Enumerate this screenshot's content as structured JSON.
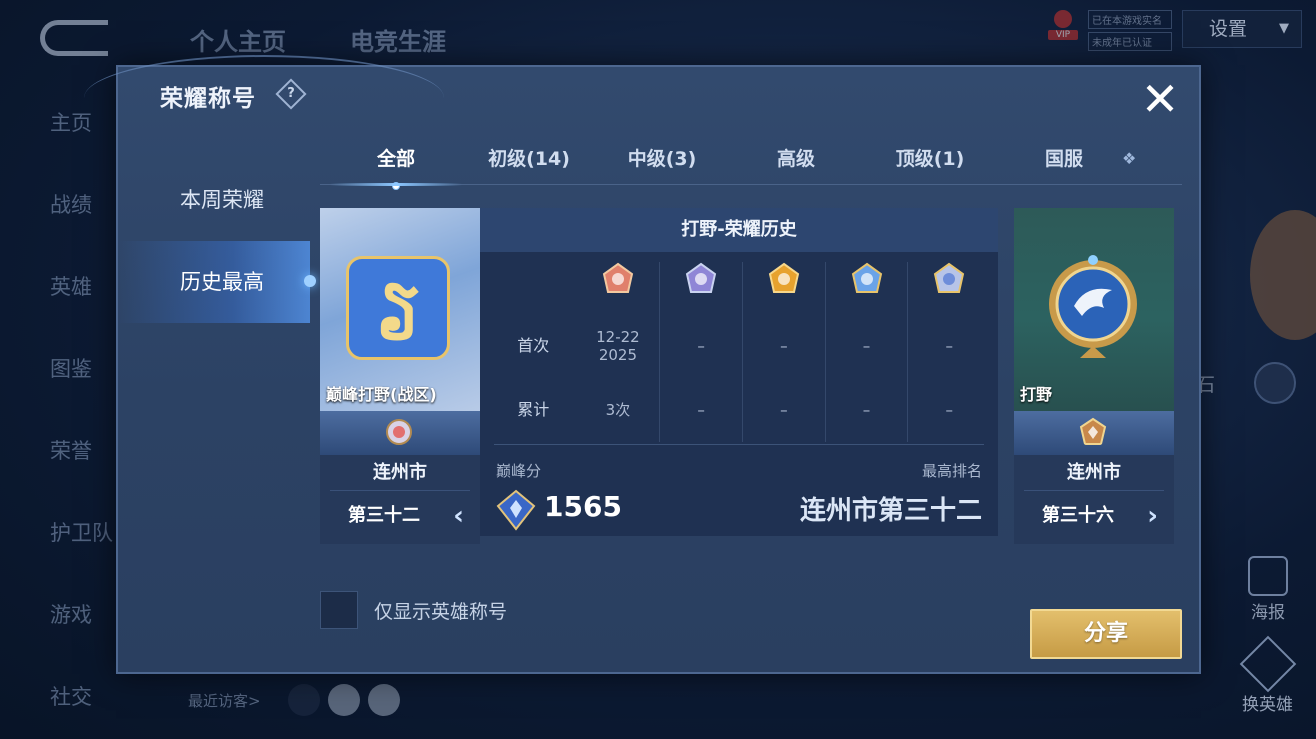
{
  "background": {
    "top_tabs": [
      "个人主页",
      "电竞生涯"
    ],
    "nav_items": [
      "主页",
      "战绩",
      "英雄",
      "图鉴",
      "荣誉",
      "护卫队",
      "游戏",
      "社交"
    ],
    "vip_tag": "VIP",
    "auth_lines": [
      "已在本游戏实名",
      "未成年已认证"
    ],
    "settings_label": "设置",
    "visitors_label": "最近访客>",
    "poster_label": "海报",
    "swap_hero_label": "换英雄",
    "stone_text": "石"
  },
  "modal": {
    "title": "荣耀称号",
    "help_glyph": "?",
    "close_glyph": "✕",
    "side_nav": [
      {
        "label": "本周荣耀",
        "active": false
      },
      {
        "label": "历史最高",
        "active": true
      }
    ],
    "tabs": [
      {
        "label": "全部",
        "active": true
      },
      {
        "label": "初级(14)",
        "active": false
      },
      {
        "label": "中级(3)",
        "active": false
      },
      {
        "label": "高级",
        "active": false
      },
      {
        "label": "顶级(1)",
        "active": false
      },
      {
        "label": "国服",
        "active": false
      }
    ],
    "tab_more_glyph": "❖",
    "left_card": {
      "caption": "巅峰打野(战区)",
      "emblem_glyph": "ຽ",
      "city": "连州市",
      "rank": "第三十二",
      "arrow": "‹"
    },
    "right_card": {
      "caption": "打野",
      "city": "连州市",
      "rank": "第三十六",
      "arrow": "›"
    },
    "history": {
      "header": "打野-荣耀历史",
      "medal_colors": [
        "#e0806c",
        "#8f86d6",
        "#e7a22e",
        "#6aa3e8",
        "#b7c4e8"
      ],
      "rows": [
        {
          "label": "首次",
          "values": [
            "12-22\n2025",
            "–",
            "–",
            "–",
            "–"
          ]
        },
        {
          "label": "累计",
          "values": [
            "3次",
            "–",
            "–",
            "–",
            "–"
          ]
        }
      ],
      "peak_label": "巅峰分",
      "peak_score": "1565",
      "best_label": "最高排名",
      "best_rank": "连州市第三十二"
    },
    "checkbox_label": "仅显示英雄称号",
    "share_label": "分享"
  }
}
